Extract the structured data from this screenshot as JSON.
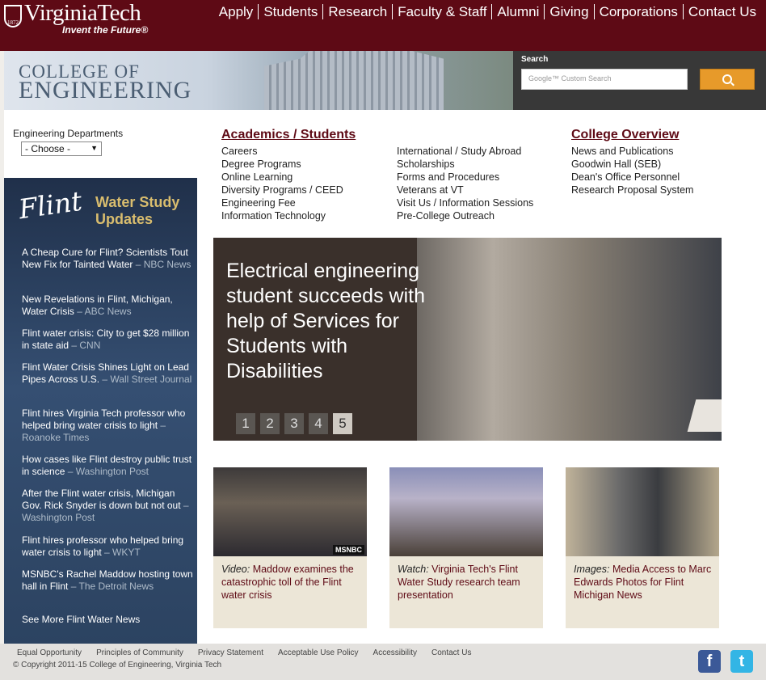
{
  "header": {
    "logo_name": "VirginiaTech",
    "logo_tagline": "Invent the Future®",
    "shield_text": "1872",
    "nav": [
      "Apply",
      "Students",
      "Research",
      "Faculty & Staff",
      "Alumni",
      "Giving",
      "Corporations",
      "Contact Us"
    ]
  },
  "banner": {
    "line1": "COLLEGE OF",
    "line2": "ENGINEERING"
  },
  "search": {
    "label": "Search",
    "placeholder": "Google™ Custom Search"
  },
  "sidebar": {
    "dept_label": "Engineering Departments",
    "dept_select": "- Choose -",
    "flint_logo": "Flint",
    "flint_title": "Water Study Updates",
    "news": [
      {
        "link": "A Cheap Cure for Flint? Scientists Tout New Fix for Tainted Water",
        "source": " – NBC News"
      },
      {
        "link": "New Revelations in Flint, Michigan, Water Crisis",
        "source": " – ABC News"
      },
      {
        "link": "Flint water crisis: City to get $28 million in state aid",
        "source": " – CNN"
      },
      {
        "link": "Flint Water Crisis Shines Light on Lead Pipes Across U.S.",
        "source": " – Wall Street Journal"
      },
      {
        "link": "Flint hires Virginia Tech professor who helped bring water crisis to light",
        "source": " – Roanoke Times"
      },
      {
        "link": "How cases like Flint destroy public trust in science",
        "source": " – Washington Post"
      },
      {
        "link": "After the Flint water crisis, Michigan Gov. Rick Snyder is down but not out",
        "source": " – Washington Post"
      },
      {
        "link": "Flint hires professor who helped bring water crisis to light",
        "source": " – WKYT"
      },
      {
        "link": "MSNBC's Rachel Maddow hosting town hall in Flint",
        "source": " – The Detroit News"
      }
    ],
    "more": "See More Flint Water News"
  },
  "links": {
    "academics_heading": "Academics / Students",
    "academics_col1": [
      "Careers",
      "Degree Programs",
      "Online Learning",
      "Diversity Programs / CEED",
      "Engineering Fee",
      "Information Technology"
    ],
    "academics_col2": [
      "International / Study Abroad",
      "Scholarships",
      "Forms and Procedures",
      "Veterans at VT",
      "Visit Us / Information Sessions",
      "Pre-College Outreach"
    ],
    "overview_heading": "College Overview",
    "overview": [
      "News and Publications",
      "Goodwin Hall (SEB)",
      "Dean's Office Personnel",
      "Research Proposal System"
    ]
  },
  "slider": {
    "caption": "Electrical engineering student succeeds with help of Services for Students with Disabilities",
    "pages": [
      "1",
      "2",
      "3",
      "4",
      "5"
    ],
    "active_page": "5"
  },
  "cards": [
    {
      "prefix": "Video:",
      "text": " Maddow examines the catastrophic toll of the Flint water crisis",
      "badge": "MSNBC"
    },
    {
      "prefix": "Watch:",
      "text": " Virginia Tech's Flint Water Study research team presentation",
      "badge": ""
    },
    {
      "prefix": "Images:",
      "text": " Media Access to Marc Edwards Photos for Flint Michigan News",
      "badge": ""
    }
  ],
  "footer": {
    "links": [
      "Equal Opportunity",
      "Principles of Community",
      "Privacy Statement",
      "Acceptable Use Policy",
      "Accessibility",
      "Contact Us"
    ],
    "copyright": "© Copyright 2011-15 College of Engineering, Virginia Tech"
  },
  "social": [
    "facebook-icon",
    "twitter-icon"
  ],
  "colors": {
    "maroon": "#5e0a15",
    "orange": "#e79a2a",
    "gold": "#d9bd6e"
  }
}
